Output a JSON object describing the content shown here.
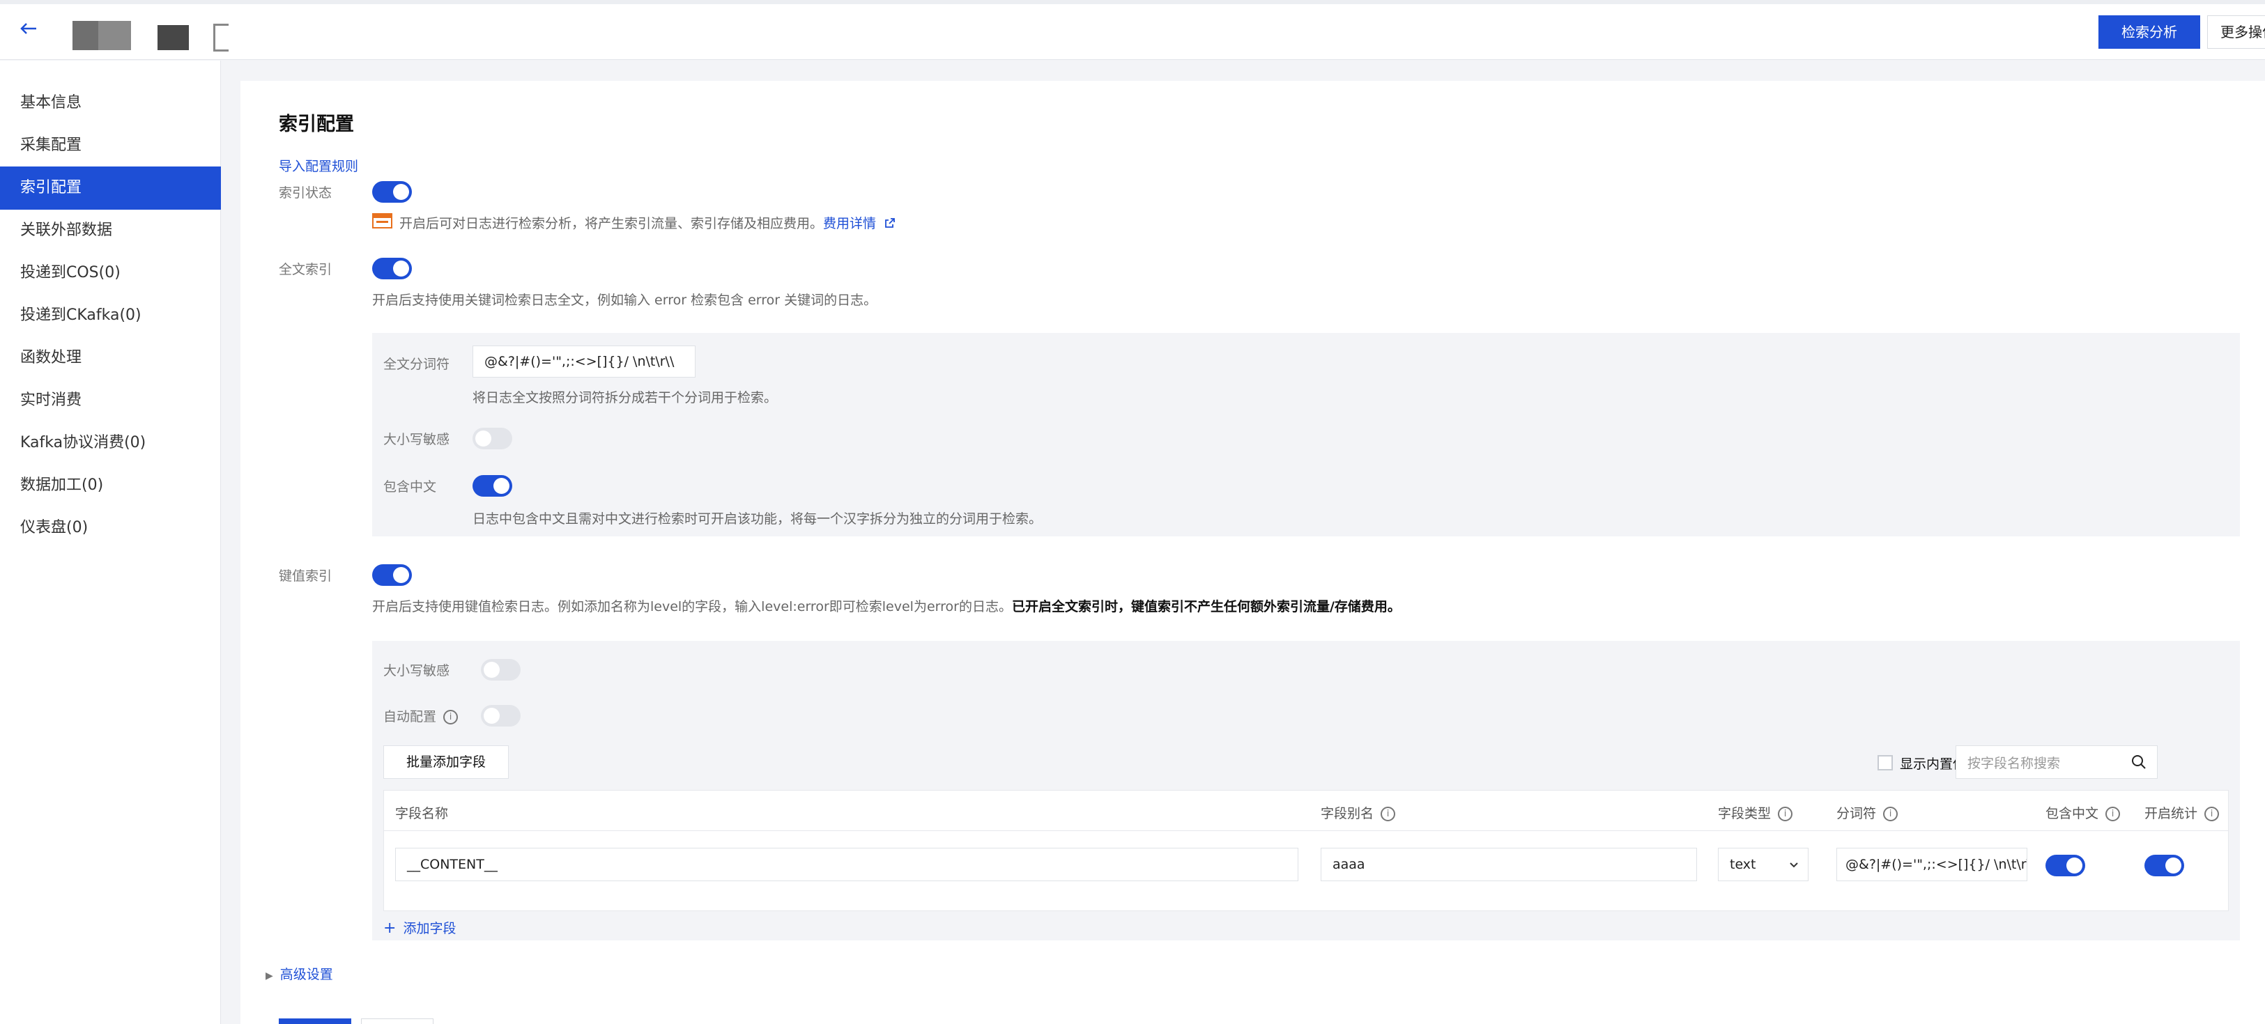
{
  "topbar": {
    "back_icon": "arrow-left-icon",
    "search_analysis_label": "检索分析",
    "more_actions_label": "更多操作"
  },
  "sidebar": {
    "items": [
      {
        "label": "基本信息"
      },
      {
        "label": "采集配置"
      },
      {
        "label": "索引配置",
        "active": true
      },
      {
        "label": "关联外部数据"
      },
      {
        "label": "投递到COS(0)"
      },
      {
        "label": "投递到CKafka(0)"
      },
      {
        "label": "函数处理"
      },
      {
        "label": "实时消费"
      },
      {
        "label": "Kafka协议消费(0)"
      },
      {
        "label": "数据加工(0)"
      },
      {
        "label": "仪表盘(0)"
      }
    ]
  },
  "main": {
    "title": "索引配置",
    "import_rules_link": "导入配置规则",
    "index_status": {
      "label": "索引状态",
      "enabled": true,
      "notice": "开启后可对日志进行检索分析，将产生索引流量、索引存储及相应费用。",
      "fee_link": "费用详情"
    },
    "fulltext": {
      "label": "全文索引",
      "enabled": true,
      "desc": "开启后支持使用关键词检索日志全文，例如输入 error 检索包含 error 关键词的日志。",
      "delimiter_label": "全文分词符",
      "delimiter_value": "@&?|#()='\",;:<>[]{}/ \\n\\t\\r\\\\",
      "delimiter_desc": "将日志全文按照分词符拆分成若干个分词用于检索。",
      "case_label": "大小写敏感",
      "case_enabled": false,
      "chinese_label": "包含中文",
      "chinese_enabled": true,
      "chinese_desc": "日志中包含中文且需对中文进行检索时可开启该功能，将每一个汉字拆分为独立的分词用于检索。"
    },
    "kv": {
      "label": "键值索引",
      "enabled": true,
      "desc_normal": "开启后支持使用键值检索日志。例如添加名称为level的字段，输入level:error即可检索level为error的日志。",
      "desc_bold": "已开启全文索引时，键值索引不产生任何额外索引流量/存储费用。",
      "case_label": "大小写敏感",
      "case_enabled": false,
      "auto_label": "自动配置",
      "auto_enabled": false,
      "batch_add_label": "批量添加字段",
      "show_builtin_label": "显示内置保留字段",
      "search_placeholder": "按字段名称搜索",
      "columns": {
        "name": "字段名称",
        "alias": "字段别名",
        "type": "字段类型",
        "delimiter": "分词符",
        "chinese": "包含中文",
        "stats": "开启统计"
      },
      "rows": [
        {
          "name": "__CONTENT__",
          "alias": "aaaa",
          "type": "text",
          "delimiter": "@&?|#()='\",;:<>[]{}/ \\n\\t\\r\\\\",
          "chinese": true,
          "stats": true
        }
      ],
      "add_field_label": "添加字段"
    },
    "advanced_label": "高级设置"
  }
}
